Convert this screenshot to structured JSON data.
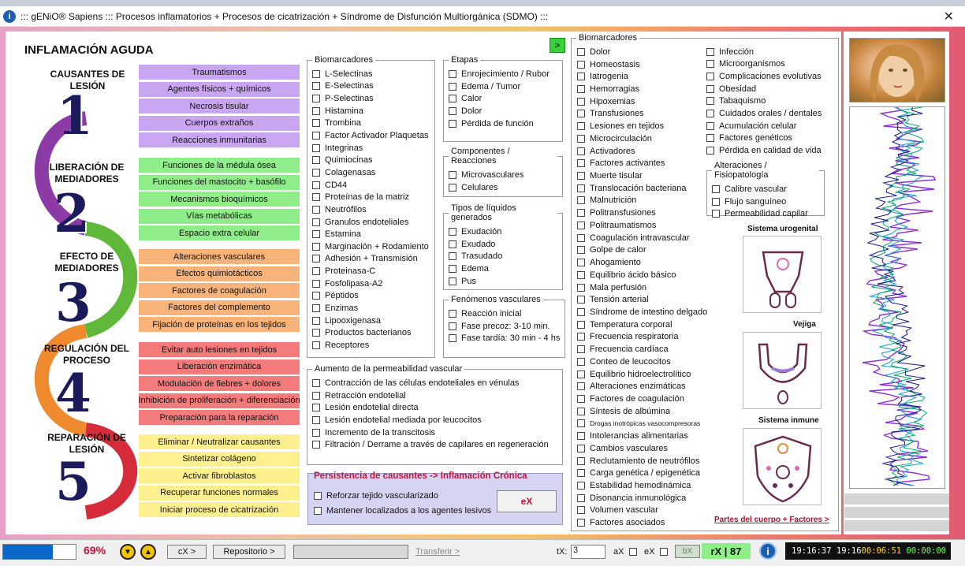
{
  "window": {
    "title": "::: gENiO® Sapiens ::: Procesos inflamatorios + Procesos de cicatrización + Síndrome de Disfunción Multiorgánica (SDMO) :::",
    "url_fragment": "web.whatsapp.com"
  },
  "section_title": "INFLAMACIÓN AGUDA",
  "next_button": ">",
  "stages": [
    {
      "title": "CAUSANTES DE LESIÓN",
      "numeral": "1",
      "color": "#c9a6f2",
      "items": [
        "Traumatismos",
        "Agentes físicos + químicos",
        "Necrosis tisular",
        "Cuerpos extraños",
        "Reacciones inmunitarias"
      ]
    },
    {
      "title": "LIBERACIÓN DE MEDIADORES",
      "numeral": "2",
      "color": "#8fee8a",
      "items": [
        "Funciones de la médula ósea",
        "Funciones del mastocito + basófilo",
        "Mecanismos bioquímicos",
        "Vías metabólicas",
        "Espacio extra celular"
      ]
    },
    {
      "title": "EFECTO DE MEDIADORES",
      "numeral": "3",
      "color": "#f7b37a",
      "items": [
        "Alteraciones vasculares",
        "Efectos quimiotácticos",
        "Factores de coagulación",
        "Factores del complemento",
        "Fijación de proteínas en los tejidos"
      ]
    },
    {
      "title": "REGULACIÓN DEL PROCESO",
      "numeral": "4",
      "color": "#f47b7b",
      "items": [
        "Evitar auto lesiones en tejidos",
        "Liberación enzimática",
        "Modulación de fiebres + dolores",
        "Inhibición de proliferación + diferenciación",
        "Preparación para la reparación"
      ]
    },
    {
      "title": "REPARACIÓN DE LESIÓN",
      "numeral": "5",
      "color": "#fff08f",
      "items": [
        "Eliminar / Neutralizar causantes",
        "Sintetizar colágeno",
        "Activar fibroblastos",
        "Recuperar funciones normales",
        "Iniciar proceso de cicatrización"
      ]
    }
  ],
  "biomarcadores_1": {
    "legend": "Biomarcadores",
    "items": [
      "L-Selectinas",
      "E-Selectinas",
      "P-Selectinas",
      "Histamina",
      "Trombina",
      "Factor Activador Plaquetas",
      "Integrinas",
      "Quimiocinas",
      "Colagenasas",
      "CD44",
      "Proteínas de la matriz",
      "Neutrófilos",
      "Granulos endoteliales",
      "Estamina",
      "Marginación + Rodamiento",
      "Adhesión + Transmisión",
      "Proteinasa-C",
      "Fosfolipasa-A2",
      "Péptidos",
      "Enzimas",
      "Lipooxigenasa",
      "Productos bacterianos",
      "Receptores"
    ]
  },
  "etapas": {
    "legend": "Etapas",
    "items": [
      "Enrojecimiento / Rubor",
      "Edema / Tumor",
      "Calor",
      "Dolor",
      "Pérdida de función"
    ]
  },
  "componentes": {
    "legend": "Componentes / Reacciones",
    "items": [
      "Microvasculares",
      "Celulares"
    ]
  },
  "liquidos": {
    "legend": "Tipos de líquidos generados",
    "items": [
      "Exudación",
      "Exudado",
      "Trasudado",
      "Edema",
      "Pus"
    ]
  },
  "fenomenos": {
    "legend": "Fenómenos vasculares",
    "items": [
      "Reacción inicial",
      "Fase precoz: 3-10 min.",
      "Fase tardía: 30 min - 4 hs"
    ]
  },
  "permeabilidad": {
    "legend": "Aumento de la permeabilidad vascular",
    "items": [
      "Contracción de las células endoteliales en vénulas",
      "Retracción endotelial",
      "Lesión endotelial directa",
      "Lesión endotelial mediada por leucocitos",
      "Incremento de la transcitosis",
      "Filtración / Derrame a través de capilares en regeneración"
    ]
  },
  "persistencia": {
    "title": "Persistencia de causantes -> Inflamación Crónica",
    "items": [
      "Reforzar tejido vascularizado",
      "Mantener localizados a los agentes lesivos"
    ],
    "button": "eX"
  },
  "biomarcadores_2": {
    "legend": "Biomarcadores",
    "items": [
      "Dolor",
      "Homeostasis",
      "Iatrogenia",
      "Hemorragias",
      "Hipoxemias",
      "Transfusiones",
      "Lesiones en tejidos",
      "Microcirculación",
      "Activadores",
      "Factores activantes",
      "Muerte tisular",
      "Translocación bacteriana",
      "Malnutrición",
      "Politransfusiones",
      "Politraumatismos",
      "Coagulación intravascular",
      "Golpe de calor",
      "Ahogamiento",
      "Equilibrio ácido básico",
      "Mala perfusión",
      "Tensión arterial",
      "Síndrome de intestino delgado",
      "Temperatura corporal",
      "Frecuencia respiratoria",
      "Frecuencia cardíaca",
      "Conteo de leucocitos",
      "Equilibrio hidroelectrolítico",
      "Alteraciones enzimáticas",
      "Factores de coagulación",
      "Síntesis de albúmina",
      "Drogas inotrópicas vasocompresoras",
      "Intolerancias alimentarias",
      "Cambios vasculares",
      "Reclutamiento de neutrófilos",
      "Carga genética / epigenética",
      "Estabilidad hemodinámica",
      "Disonancia inmunológica",
      "Volumen vascular",
      "Factores asociados"
    ]
  },
  "biomarcadores_3": {
    "items": [
      "Infección",
      "Microorganismos",
      "Complicaciones evolutivas",
      "Obesidad",
      "Tabaquismo",
      "Cuidados orales / dentales",
      "Acumulación celular",
      "Factores genéticos",
      "Pérdida en calidad de vida"
    ]
  },
  "alteraciones": {
    "legend": "Alteraciones / Fisiopatología",
    "items": [
      "Calibre vascular",
      "Flujo sanguíneo",
      "Permeabilidad capilar"
    ]
  },
  "systems": [
    {
      "title": "Sistema urogenital"
    },
    {
      "title": "Vejiga"
    },
    {
      "title": "Sistema inmune"
    }
  ],
  "parts_link": "Partes del cuerpo + Factores >",
  "statusbar": {
    "progress_pct": 69,
    "progress_label": "69%",
    "cx_button": "cX >",
    "repo_button": "Repositorio >",
    "transfer_link": "Transferir >",
    "tx_label": "tX:",
    "tx_value": "3",
    "ax_label": "aX",
    "ex_label": "eX",
    "bx_button": "bX",
    "rx_label": "rX | 87",
    "clock_a": "19:16:37",
    "clock_b": "19:16",
    "clock_c": "00:06:51",
    "clock_d": "00:00:00"
  }
}
